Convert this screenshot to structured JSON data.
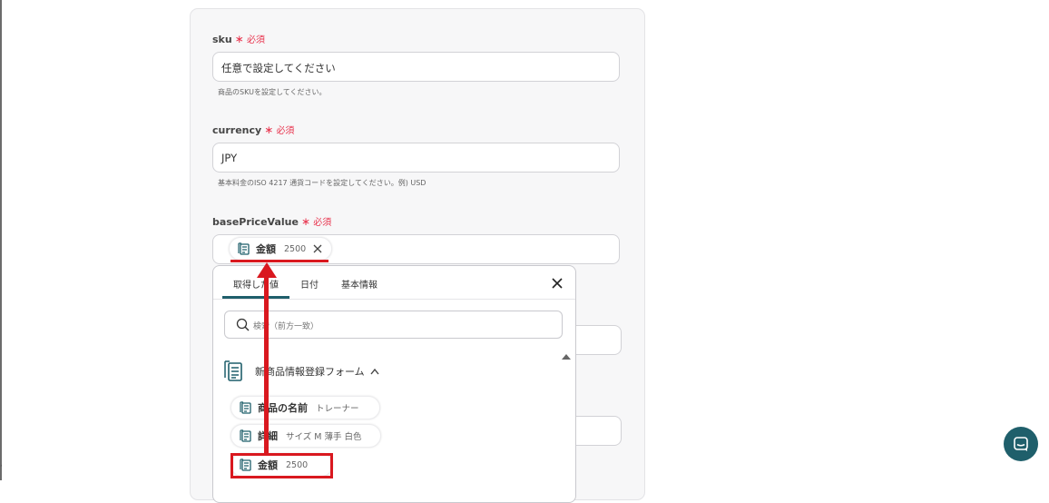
{
  "form": {
    "required_label": "必須",
    "sku": {
      "label": "sku",
      "value": "任意で設定してください",
      "help": "商品のSKUを設定してください。"
    },
    "currency": {
      "label": "currency",
      "value": "JPY",
      "help": "基本料金のISO 4217 通貨コードを設定してください。例) USD"
    },
    "basePriceValue": {
      "label": "basePriceValue",
      "token_label": "金額",
      "token_value": "2500"
    }
  },
  "dropdown": {
    "tabs": [
      {
        "label": "取得した値"
      },
      {
        "label": "日付"
      },
      {
        "label": "基本情報"
      }
    ],
    "search_placeholder": "検索（前方一致）",
    "group": {
      "label": "新商品情報登録フォーム",
      "items": [
        {
          "label": "商品の名前",
          "value": "トレーナー"
        },
        {
          "label": "詳細",
          "value": "サイズ M 薄手 白色"
        },
        {
          "label": "金額",
          "value": "2500"
        }
      ]
    }
  },
  "colors": {
    "accent": "#1f5f6b",
    "required": "#e8334d",
    "annotation_red": "#d9181f"
  },
  "icons": {
    "close": "close-icon",
    "search": "search-icon",
    "form_value": "form-value-icon",
    "chat": "chat-icon"
  }
}
